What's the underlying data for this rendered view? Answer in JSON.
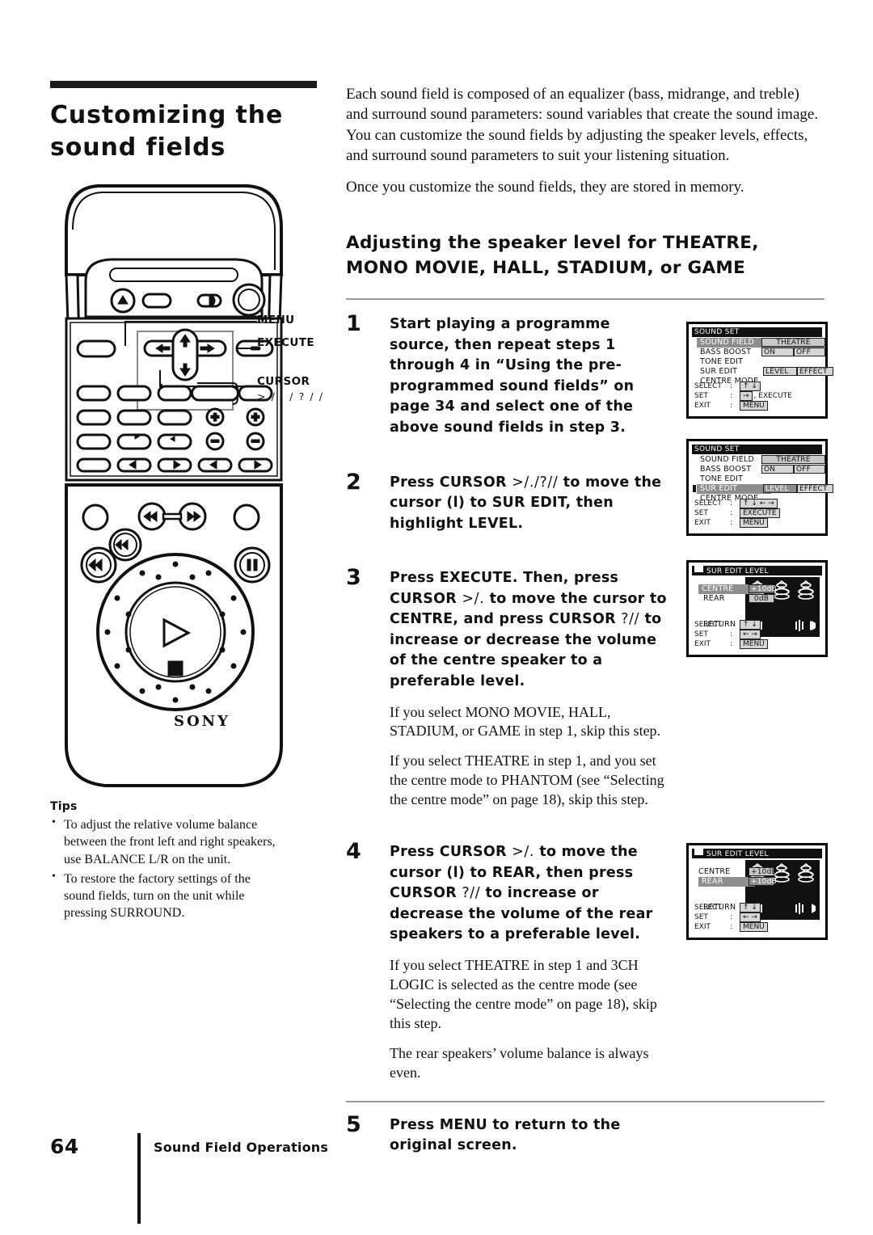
{
  "title": "Customizing the sound fields",
  "intro": {
    "p1": "Each sound field is composed of an equalizer (bass, midrange, and treble) and surround sound parameters: sound variables that create the sound image.  You can customize the sound fields by adjusting the speaker levels, effects, and surround sound parameters to suit your listening situation.",
    "p2": "Once you customize the sound fields, they are stored in memory."
  },
  "section_heading": "Adjusting the speaker level for THEATRE, MONO MOVIE, HALL, STADIUM, or GAME",
  "remote_callouts": {
    "menu": "MENU",
    "execute": "EXECUTE",
    "cursor": "CURSOR",
    "cursor_symbols": "> / . / ? / /",
    "brand": "SONY"
  },
  "steps": [
    {
      "num": "1",
      "text": "Start playing a programme source, then repeat steps 1 through 4 in “Using the pre-programmed sound fields” on page 34 and select one of the above sound fields in step 3.",
      "notes": []
    },
    {
      "num": "2",
      "text_pre": "Press CURSOR ",
      "text_sym": ">/./?//",
      "text_post": " to move the cursor (l) to SUR EDIT, then highlight LEVEL.",
      "notes": []
    },
    {
      "num": "3",
      "text_pre": "Press EXECUTE. Then, press CURSOR ",
      "text_sym": ">/.",
      "text_mid": " to move the cursor to CENTRE, and press CURSOR ",
      "text_sym2": "?//",
      "text_post": " to increase or decrease the volume of the centre speaker to a preferable level.",
      "notes": [
        "If you select MONO MOVIE, HALL, STADIUM, or GAME in step 1, skip this step.",
        "If you select THEATRE in step 1, and you set the centre mode to PHANTOM (see “Selecting the centre mode” on page 18), skip this step."
      ]
    },
    {
      "num": "4",
      "text_pre": "Press CURSOR ",
      "text_sym": ">/.",
      "text_mid": " to move the cursor (l) to REAR, then press CURSOR ",
      "text_sym2": "?//",
      "text_post": " to increase or decrease the volume of the rear speakers to a preferable level.",
      "notes": [
        "If you select THEATRE in step 1 and 3CH LOGIC is selected as the centre mode (see “Selecting the centre mode” on page 18), skip this step.",
        "The rear speakers’ volume balance is always even."
      ]
    },
    {
      "num": "5",
      "text": "Press MENU to return to the original screen.",
      "notes": []
    }
  ],
  "osd": {
    "sound_set": {
      "title": "SOUND SET",
      "rows": [
        {
          "label": "SOUND FIELD",
          "value": "THEATRE"
        },
        {
          "label": "BASS BOOST",
          "opt1": "ON",
          "opt2": "OFF"
        },
        {
          "label": "TONE EDIT"
        },
        {
          "label": "SUR EDIT",
          "opt1": "LEVEL",
          "opt2": "EFFECT"
        },
        {
          "label": "CENTRE MODE"
        }
      ],
      "keys": [
        {
          "name": "SELECT",
          "value": "↑ ↓"
        },
        {
          "name": "SET",
          "value": "→",
          "value2": ", EXECUTE"
        },
        {
          "name": "EXIT",
          "value": "MENU"
        }
      ]
    },
    "sound_set_step2": {
      "title": "SOUND SET",
      "keys": [
        {
          "name": "SELECT",
          "value": "↑ ↓ ← →"
        },
        {
          "name": "SET",
          "value": "EXECUTE"
        },
        {
          "name": "EXIT",
          "value": "MENU"
        }
      ]
    },
    "sur_edit": {
      "title": "SUR EDIT LEVEL",
      "rows": [
        {
          "label": "CENTRE",
          "value": "+10dB"
        },
        {
          "label": "REAR",
          "value": "0dB"
        }
      ],
      "return_label": "RETURN",
      "keys": [
        {
          "name": "SELECT",
          "value": "↑ ↓"
        },
        {
          "name": "SET",
          "value": "← →"
        },
        {
          "name": "EXIT",
          "value": "MENU"
        }
      ]
    },
    "sur_edit_rear": {
      "title": "SUR EDIT LEVEL",
      "rows": [
        {
          "label": "CENTRE",
          "value": "+10dB"
        },
        {
          "label": "REAR",
          "value": "+10dB"
        }
      ],
      "return_label": "RETURN"
    }
  },
  "tips": {
    "heading": "Tips",
    "items": [
      "To adjust the relative volume balance between the front left and right speakers, use BALANCE L/R on the unit.",
      "To restore the factory settings of the sound fields, turn on the unit while pressing SURROUND."
    ]
  },
  "footer": {
    "page": "64",
    "chapter": "Sound Field Operations"
  }
}
